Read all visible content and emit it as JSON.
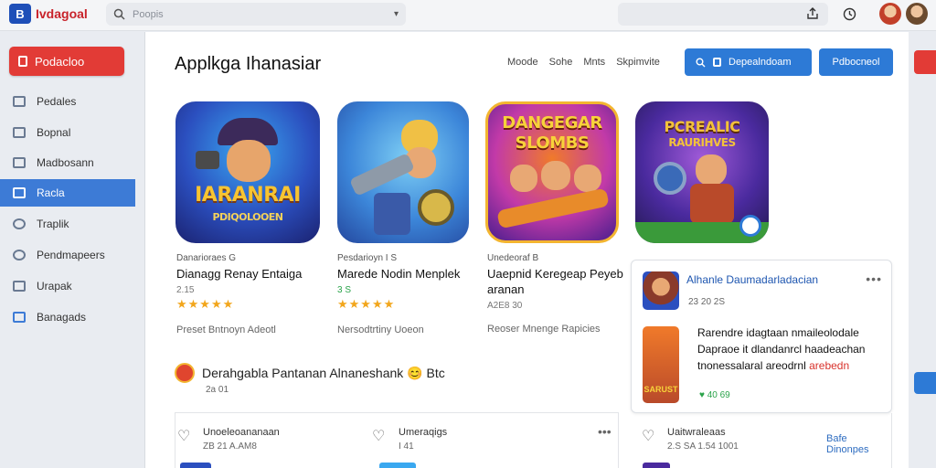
{
  "app": {
    "logo_letter": "B",
    "name": "Ivdagoal",
    "brand_color": "#c8222a"
  },
  "search": {
    "placeholder": "Poopis"
  },
  "sidebar": {
    "cta_label": "Podacloo",
    "items": [
      {
        "label": "Pedales",
        "active": false
      },
      {
        "label": "Bopnal",
        "active": false
      },
      {
        "label": "Madbosann",
        "active": false
      },
      {
        "label": "Racla",
        "active": true
      },
      {
        "label": "Traplik",
        "active": false
      },
      {
        "label": "Pendmapeers",
        "active": false
      },
      {
        "label": "Urapak",
        "active": false
      },
      {
        "label": "Banagads",
        "active": false
      }
    ]
  },
  "main": {
    "title": "Applkga Ihanasiar",
    "nav_links": [
      "Moode",
      "Sohe",
      "Mnts",
      "Skpimvite"
    ],
    "search_button": "Depealndoam",
    "primary_button": "Pdbocneol"
  },
  "apps": [
    {
      "art_title": "IARANRAI",
      "art_subtitle": "PDIQOLOOEN",
      "sub": "Danarioraes G",
      "name": "Dianagg Renay Entaiga",
      "rating": "2.15",
      "stars": "★★★★★",
      "desc": "Preset Bntnoyn Adeotl"
    },
    {
      "sub": "Pesdarioyn I S",
      "name": "Marede Nodin Menplek",
      "rating": "3 S",
      "stars": "★★★★★",
      "desc": "Nersodtrtiny Uoeon"
    },
    {
      "art_title": "DANGEGAR",
      "art_subtitle": "SLOMBS",
      "sub": "Unedeoraf B",
      "name": "Uaepnid Keregeap Peyeb aranan",
      "rating": "A2E8 30",
      "desc": "Reoser Mnenge Rapicies"
    },
    {
      "art_title": "PCREALIC",
      "art_subtitle": "RAURIHVES"
    }
  ],
  "feature": {
    "text": "Derahgabla Pantanan Alnaneshank 😊 Btc",
    "sub": "2a 01"
  },
  "side_panel": {
    "title": "Alhanle Daumadarladacian",
    "meta": "23 20 2S",
    "more": "•••",
    "body_lines": [
      "Rarendre idagtaan nmaileolodale",
      "Dapraoe it dlandanrcl haadeachan",
      "tnonessalaral areodrnl"
    ],
    "body_accent": "arebedn",
    "foot": "♥ 40 69",
    "thumb_label": "SARUST"
  },
  "list": [
    {
      "title": "Unoeleoananaan",
      "sub": "ZB 21 A.AM8"
    },
    {
      "title": "Umeraqigs",
      "sub": "I 41"
    },
    {
      "title": "Uaitwraleaas",
      "sub": "2.S SA 1.54 1001"
    }
  ],
  "list_link": "Bafe Dinonpes",
  "colors": {
    "accent": "#3d7bd6",
    "cta": "#e23b36",
    "star": "#f2a61c"
  }
}
